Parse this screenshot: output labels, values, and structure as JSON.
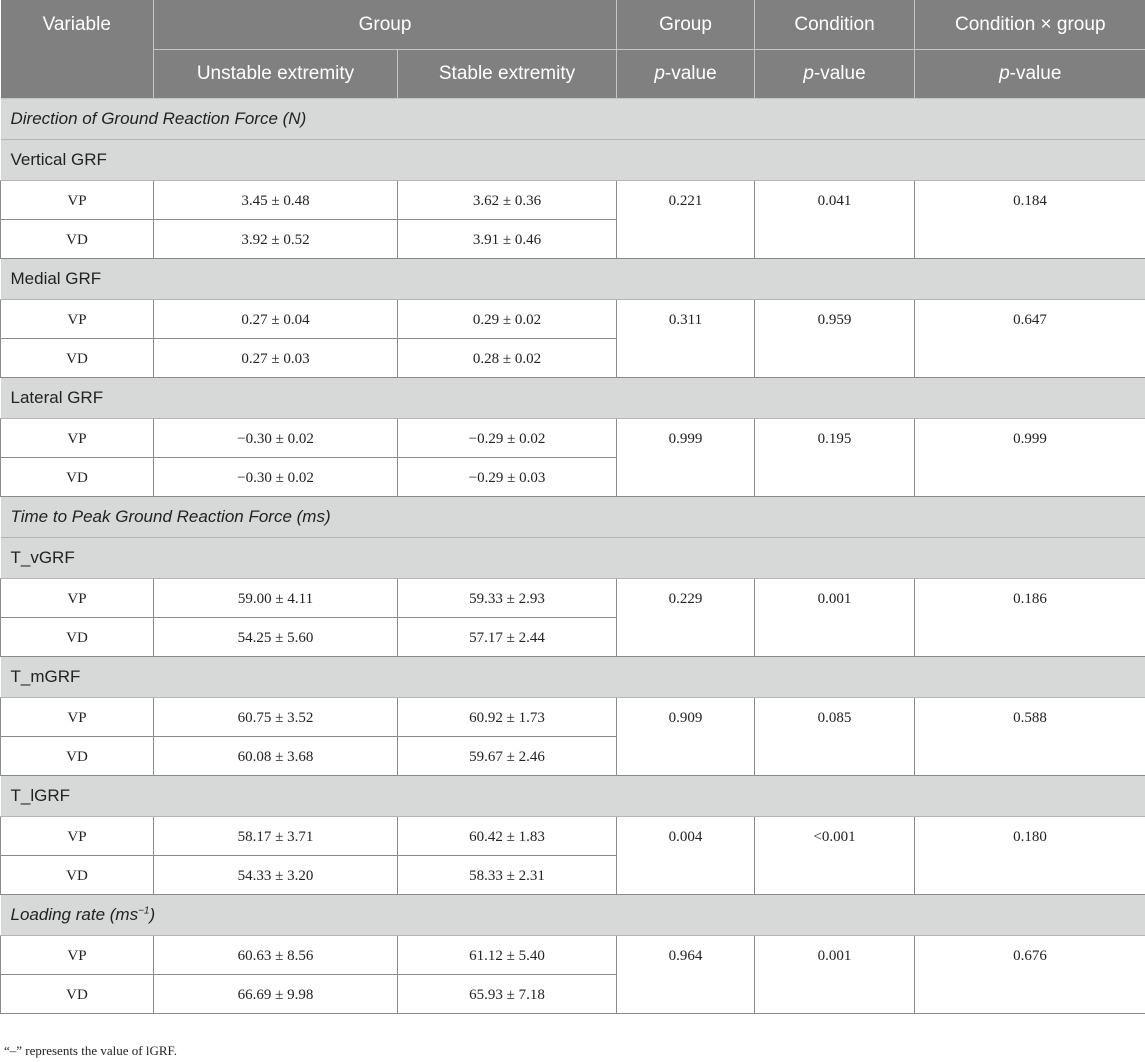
{
  "header": {
    "variable": "Variable",
    "group": "Group",
    "group_p": "Group",
    "condition": "Condition",
    "interaction": "Condition × group",
    "unstable": "Unstable extremity",
    "stable": "Stable extremity",
    "p": "p",
    "value_suffix": "-value"
  },
  "sections": {
    "direction": "Direction of Ground Reaction Force (N)",
    "time_to_peak": "Time to Peak Ground Reaction Force (ms)",
    "loading_rate_base": "Loading rate (ms",
    "loading_rate_sup": "−1",
    "loading_rate_end": ")"
  },
  "blocks": {
    "vertical": {
      "label": "Vertical GRF",
      "rows": [
        {
          "cond": "VP",
          "unstable": "3.45 ± 0.48",
          "stable": "3.62 ± 0.36"
        },
        {
          "cond": "VD",
          "unstable": "3.92 ± 0.52",
          "stable": "3.91 ± 0.46"
        }
      ],
      "group_p": "0.221",
      "condition_p": "0.041",
      "interaction_p": "0.184"
    },
    "medial": {
      "label": "Medial GRF",
      "rows": [
        {
          "cond": "VP",
          "unstable": "0.27 ± 0.04",
          "stable": "0.29 ± 0.02"
        },
        {
          "cond": "VD",
          "unstable": "0.27 ± 0.03",
          "stable": "0.28 ± 0.02"
        }
      ],
      "group_p": "0.311",
      "condition_p": "0.959",
      "interaction_p": "0.647"
    },
    "lateral": {
      "label": "Lateral GRF",
      "rows": [
        {
          "cond": "VP",
          "unstable": "−0.30 ± 0.02",
          "stable": "−0.29 ± 0.02"
        },
        {
          "cond": "VD",
          "unstable": "−0.30 ± 0.02",
          "stable": "−0.29 ± 0.03"
        }
      ],
      "group_p": "0.999",
      "condition_p": "0.195",
      "interaction_p": "0.999"
    },
    "t_vgrf": {
      "label": "T_vGRF",
      "rows": [
        {
          "cond": "VP",
          "unstable": "59.00 ± 4.11",
          "stable": "59.33 ± 2.93"
        },
        {
          "cond": "VD",
          "unstable": "54.25 ± 5.60",
          "stable": "57.17 ± 2.44"
        }
      ],
      "group_p": "0.229",
      "condition_p": "0.001",
      "interaction_p": "0.186"
    },
    "t_mgrf": {
      "label": "T_mGRF",
      "rows": [
        {
          "cond": "VP",
          "unstable": "60.75 ± 3.52",
          "stable": "60.92 ± 1.73"
        },
        {
          "cond": "VD",
          "unstable": "60.08 ± 3.68",
          "stable": "59.67 ± 2.46"
        }
      ],
      "group_p": "0.909",
      "condition_p": "0.085",
      "interaction_p": "0.588"
    },
    "t_lgrf": {
      "label": "T_lGRF",
      "rows": [
        {
          "cond": "VP",
          "unstable": "58.17 ± 3.71",
          "stable": "60.42 ± 1.83"
        },
        {
          "cond": "VD",
          "unstable": "54.33 ± 3.20",
          "stable": "58.33 ± 2.31"
        }
      ],
      "group_p": "0.004",
      "condition_p": "<0.001",
      "interaction_p": "0.180"
    },
    "loading": {
      "rows": [
        {
          "cond": "VP",
          "unstable": "60.63 ± 8.56",
          "stable": "61.12 ± 5.40"
        },
        {
          "cond": "VD",
          "unstable": "66.69 ± 9.98",
          "stable": "65.93 ± 7.18"
        }
      ],
      "group_p": "0.964",
      "condition_p": "0.001",
      "interaction_p": "0.676"
    }
  },
  "footnote": "“–” represents the value of lGRF."
}
